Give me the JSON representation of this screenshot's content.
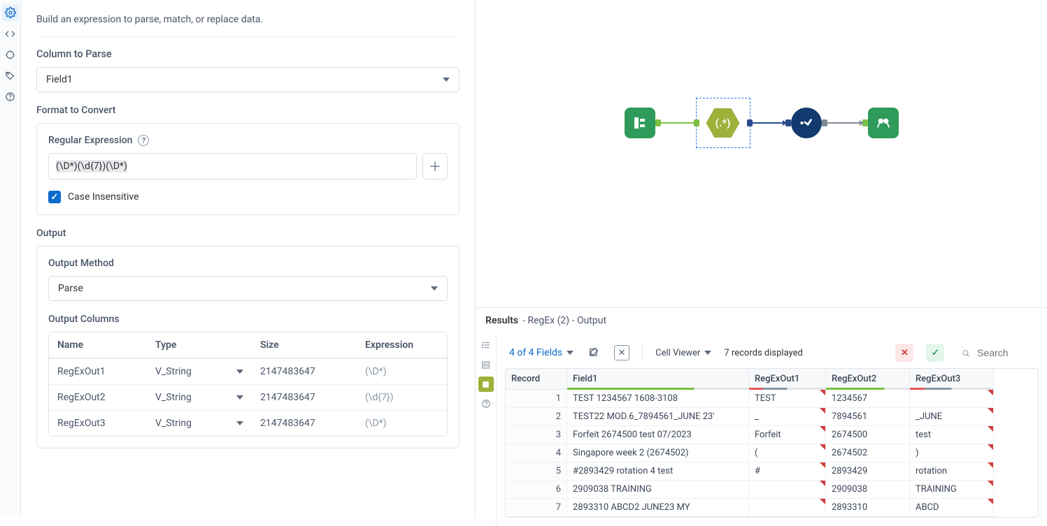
{
  "intro": "Build an expression to parse, match, or replace data.",
  "column_to_parse": {
    "label": "Column to Parse",
    "value": "Field1"
  },
  "format_to_convert": {
    "label": "Format to Convert"
  },
  "regex": {
    "label": "Regular Expression",
    "value": "(\\D*)(\\d{7})(\\D*)"
  },
  "case_insensitive": {
    "label": "Case Insensitive",
    "checked": true
  },
  "output": {
    "label": "Output"
  },
  "output_method": {
    "label": "Output Method",
    "value": "Parse"
  },
  "output_columns": {
    "label": "Output Columns",
    "headers": {
      "name": "Name",
      "type": "Type",
      "size": "Size",
      "expr": "Expression"
    },
    "rows": [
      {
        "name": "RegExOut1",
        "type": "V_String",
        "size": "2147483647",
        "expr": "(\\D*)"
      },
      {
        "name": "RegExOut2",
        "type": "V_String",
        "size": "2147483647",
        "expr": "(\\d{7})"
      },
      {
        "name": "RegExOut3",
        "type": "V_String",
        "size": "2147483647",
        "expr": "(\\D*)"
      }
    ]
  },
  "results": {
    "title_strong": "Results",
    "title_rest": " - RegEx (2) - Output",
    "fields_text": "4 of 4 Fields",
    "cell_viewer": "Cell Viewer",
    "records_text": "7 records displayed",
    "search_placeholder": "Search",
    "headers": [
      "Record",
      "Field1",
      "RegExOut1",
      "RegExOut2",
      "RegExOut3"
    ],
    "rows": [
      {
        "rec": "1",
        "f1": "TEST 1234567 1608-3108",
        "r1": "TEST",
        "r2": "1234567",
        "r3": ""
      },
      {
        "rec": "2",
        "f1": "TEST22 MOD.6_7894561_JUNE 23'",
        "r1": "_",
        "r2": "7894561",
        "r3": "_JUNE"
      },
      {
        "rec": "3",
        "f1": "Forfeit 2674500 test 07/2023",
        "r1": "Forfeit",
        "r2": "2674500",
        "r3": "test"
      },
      {
        "rec": "4",
        "f1": "Singapore week 2 (2674502)",
        "r1": "(",
        "r2": "2674502",
        "r3": ")"
      },
      {
        "rec": "5",
        "f1": "#2893429 rotation 4 test",
        "r1": "#",
        "r2": "2893429",
        "r3": "rotation"
      },
      {
        "rec": "6",
        "f1": "2909038 TRAINING",
        "r1": "",
        "r2": "2909038",
        "r3": "TRAINING"
      },
      {
        "rec": "7",
        "f1": "2893310 ABCD2 JUNE23 MY",
        "r1": "",
        "r2": "2893310",
        "r3": "ABCD"
      }
    ]
  }
}
